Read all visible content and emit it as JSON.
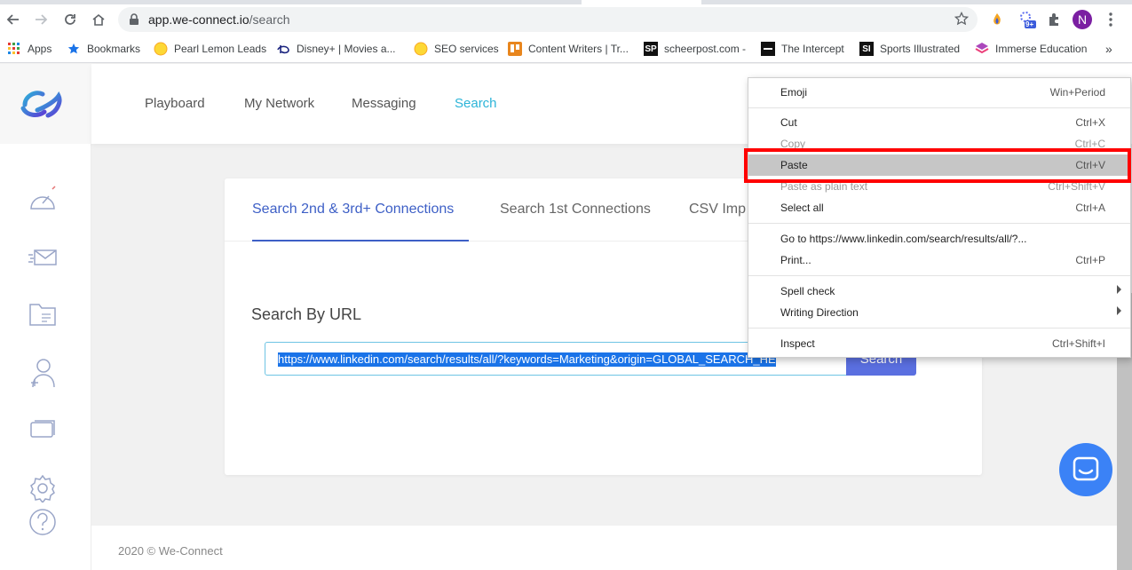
{
  "browser": {
    "url_host": "app.we-connect.io",
    "url_path": "/search",
    "profile_initial": "N",
    "extension_badge": "9+",
    "bookmarks": [
      {
        "label": "Apps"
      },
      {
        "label": "Bookmarks"
      },
      {
        "label": "Pearl Lemon Leads"
      },
      {
        "label": "Disney+ | Movies a..."
      },
      {
        "label": "SEO services"
      },
      {
        "label": "Content Writers | Tr..."
      },
      {
        "label": "scheerpost.com -"
      },
      {
        "label": "The Intercept"
      },
      {
        "label": "Sports Illustrated"
      },
      {
        "label": "Immerse Education"
      }
    ],
    "bookmarks_more": "»"
  },
  "header": {
    "nav": [
      {
        "label": "Playboard"
      },
      {
        "label": "My Network"
      },
      {
        "label": "Messaging"
      },
      {
        "label": "Search"
      }
    ]
  },
  "search": {
    "tabs": [
      {
        "label": "Search 2nd & 3rd+ Connections"
      },
      {
        "label": "Search 1st Connections"
      },
      {
        "label": "CSV Imp"
      }
    ],
    "section_title": "Search By URL",
    "url_value": "https://www.linkedin.com/search/results/all/?keywords=Marketing&origin=GLOBAL_SEARCH_HE",
    "button_label": "Search"
  },
  "footer": {
    "text": "2020 © We-Connect"
  },
  "context_menu": {
    "items": [
      {
        "label": "Emoji",
        "shortcut": "Win+Period"
      },
      {
        "label": "Cut",
        "shortcut": "Ctrl+X"
      },
      {
        "label": "Copy",
        "shortcut": "Ctrl+C"
      },
      {
        "label": "Paste",
        "shortcut": "Ctrl+V"
      },
      {
        "label": "Paste as plain text",
        "shortcut": "Ctrl+Shift+V"
      },
      {
        "label": "Select all",
        "shortcut": "Ctrl+A"
      },
      {
        "label": "Go to https://www.linkedin.com/search/results/all/?...",
        "shortcut": ""
      },
      {
        "label": "Print...",
        "shortcut": "Ctrl+P"
      },
      {
        "label": "Spell check",
        "shortcut": ""
      },
      {
        "label": "Writing Direction",
        "shortcut": ""
      },
      {
        "label": "Inspect",
        "shortcut": "Ctrl+Shift+I"
      }
    ]
  },
  "colors": {
    "accent": "#3d5fc6",
    "nav_active": "#2cb4d8",
    "button": "#5a6fe0",
    "highlight_box": "#ff0000"
  }
}
